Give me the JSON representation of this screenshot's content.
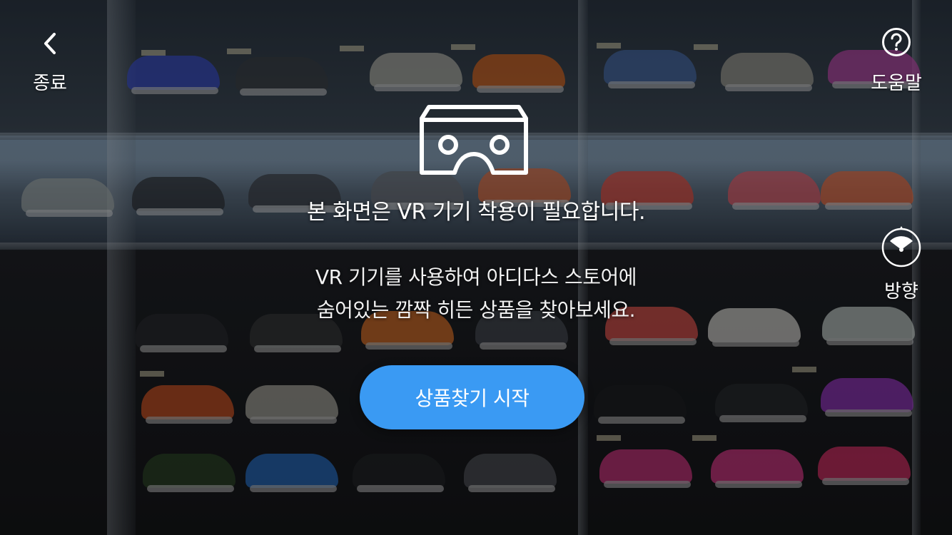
{
  "header": {
    "exit_label": "종료",
    "help_label": "도움말"
  },
  "side_controls": {
    "direction_label": "방향"
  },
  "notice": {
    "main_text": "본 화면은 VR 기기 착용이 필요합니다.",
    "sub_line_1": "VR 기기를 사용하여 아디다스 스토어에",
    "sub_line_2": "숨어있는 깜짝 히든 상품을 찾아보세요."
  },
  "start_button": {
    "label": "상품찾기 시작"
  },
  "icons": {
    "exit": "back-chevron-icon",
    "help": "question-circle-icon",
    "direction": "compass-direction-icon",
    "vr": "vr-headset-icon"
  },
  "colors": {
    "accent": "#3a9af3",
    "text": "#ffffff"
  }
}
